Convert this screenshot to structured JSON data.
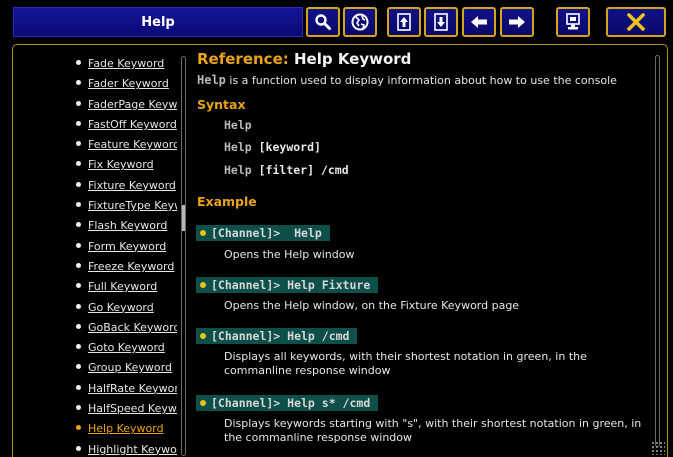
{
  "window": {
    "title": "Help"
  },
  "toolbar": [
    {
      "name": "search-icon"
    },
    {
      "name": "globe-icon"
    },
    {
      "name": "scroll-up-icon"
    },
    {
      "name": "scroll-down-icon"
    },
    {
      "name": "back-arrow-icon"
    },
    {
      "name": "forward-arrow-icon"
    },
    {
      "name": "keyboard-icon"
    },
    {
      "name": "close-icon"
    }
  ],
  "sidebar": {
    "items": [
      "Fade Keyword",
      "Fader Keyword",
      "FaderPage Keyword",
      "FastOff Keyword",
      "Feature Keyword",
      "Fix Keyword",
      "Fixture Keyword",
      "FixtureType Keyword",
      "Flash Keyword",
      "Form Keyword",
      "Freeze Keyword",
      "Full Keyword",
      "Go Keyword",
      "GoBack Keyword",
      "Goto Keyword",
      "Group Keyword",
      "HalfRate Keyword",
      "HalfSpeed Keyword",
      "Help Keyword",
      "Highlight Keyword"
    ],
    "active_index": 18
  },
  "content": {
    "heading_prefix": "Reference:",
    "heading_title": "Help Keyword",
    "intro_keyword": "Help",
    "intro_text": " is a function used to display information about how to use the console",
    "syntax_title": "Syntax",
    "syntax": [
      {
        "kw": "Help",
        "rest": ""
      },
      {
        "kw": "Help",
        "rest": " [keyword]"
      },
      {
        "kw": "Help",
        "rest": " [filter] /cmd"
      }
    ],
    "example_title": "Example",
    "examples": [
      {
        "cmd": "[Channel]>  Help",
        "desc": "Opens the Help window"
      },
      {
        "cmd": "[Channel]> Help Fixture",
        "desc": "Opens the Help window, on the Fixture Keyword page"
      },
      {
        "cmd": "[Channel]> Help /cmd",
        "desc": "Displays all keywords, with their shortest notation in green, in the commanline response window"
      },
      {
        "cmd": "[Channel]> Help s* /cmd",
        "desc": "Displays keywords starting with \"s\", with their shortest notation in green, in the commanline response window"
      }
    ]
  },
  "colors": {
    "accent": "#e8a317",
    "title_bar": "#141496",
    "command_highlight": "#0e4f4a"
  }
}
